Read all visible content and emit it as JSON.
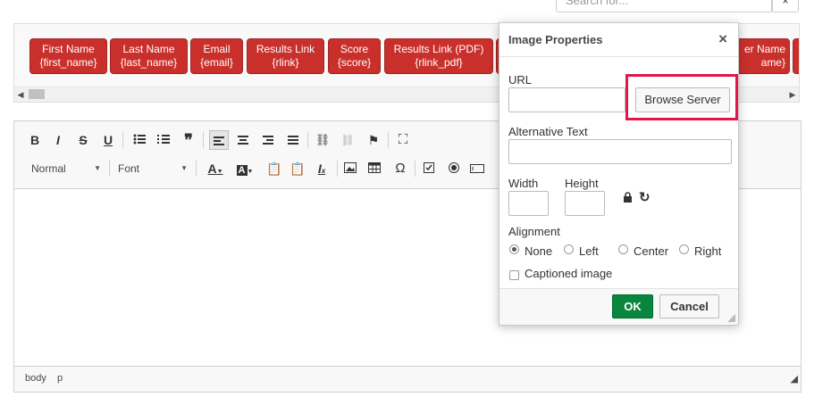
{
  "search": {
    "placeholder": "Search for..."
  },
  "tags": [
    {
      "name": "First Name",
      "code": "{first_name}"
    },
    {
      "name": "Last Name",
      "code": "{last_name}"
    },
    {
      "name": "Email",
      "code": "{email}"
    },
    {
      "name": "Results Link",
      "code": "{rlink}"
    },
    {
      "name": "Score",
      "code": "{score}"
    },
    {
      "name": "Results Link (PDF)",
      "code": "{rlink_pdf}"
    },
    {
      "name": "er Name",
      "code": "ame}"
    }
  ],
  "editor": {
    "format_combo": "Normal",
    "font_combo": "Font",
    "status_path": [
      "body",
      "p"
    ]
  },
  "dialog": {
    "title": "Image Properties",
    "url_label": "URL",
    "url_value": "",
    "browse_label": "Browse Server",
    "alt_label": "Alternative Text",
    "alt_value": "",
    "width_label": "Width",
    "height_label": "Height",
    "alignment_label": "Alignment",
    "alignment_options": [
      "None",
      "Left",
      "Center",
      "Right"
    ],
    "alignment_selected": "None",
    "captioned_label": "Captioned image",
    "ok_label": "OK",
    "cancel_label": "Cancel"
  },
  "colors": {
    "tag_bg": "#c9302c",
    "ok_bg": "#09863e",
    "highlight": "#e3154c"
  }
}
